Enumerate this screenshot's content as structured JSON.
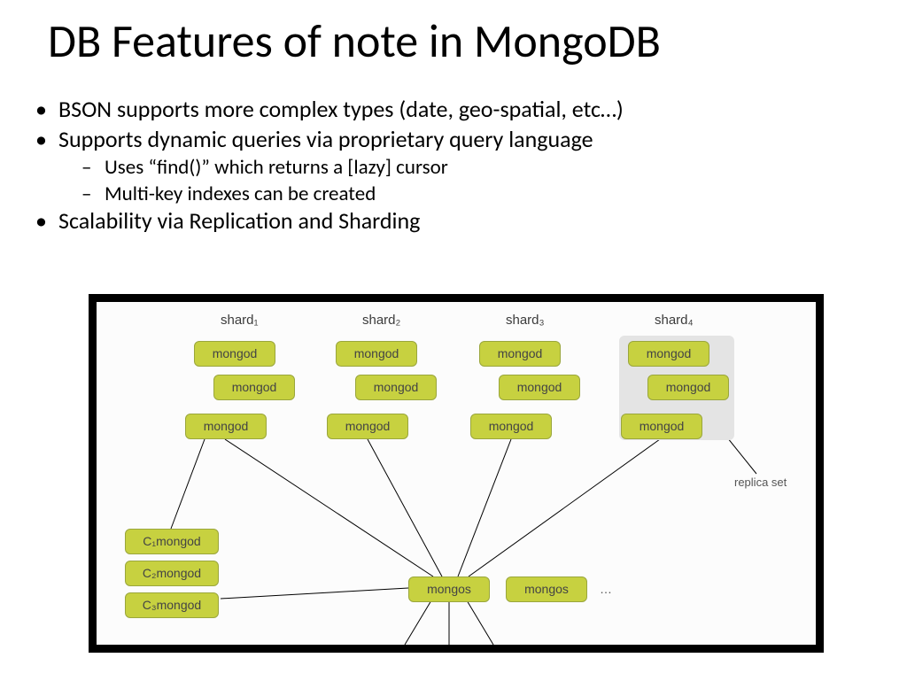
{
  "title": "DB Features of note in MongoDB",
  "bullets": {
    "b1": "BSON supports more complex types (date, geo-spatial, etc…)",
    "b2": "Supports dynamic queries via proprietary query language",
    "b2a": "Uses “find()” which returns a [lazy] cursor",
    "b2b": "Multi-key indexes can be created",
    "b3": "Scalability via Replication and Sharding"
  },
  "diagram": {
    "shard_labels": [
      "shard₁",
      "shard₂",
      "shard₃",
      "shard₄"
    ],
    "mongod": "mongod",
    "mongos": "mongos",
    "config_mongod": [
      "C₁mongod",
      "C₂mongod",
      "C₃mongod"
    ],
    "replica_set_label": "replica set",
    "ellipsis": "…"
  }
}
